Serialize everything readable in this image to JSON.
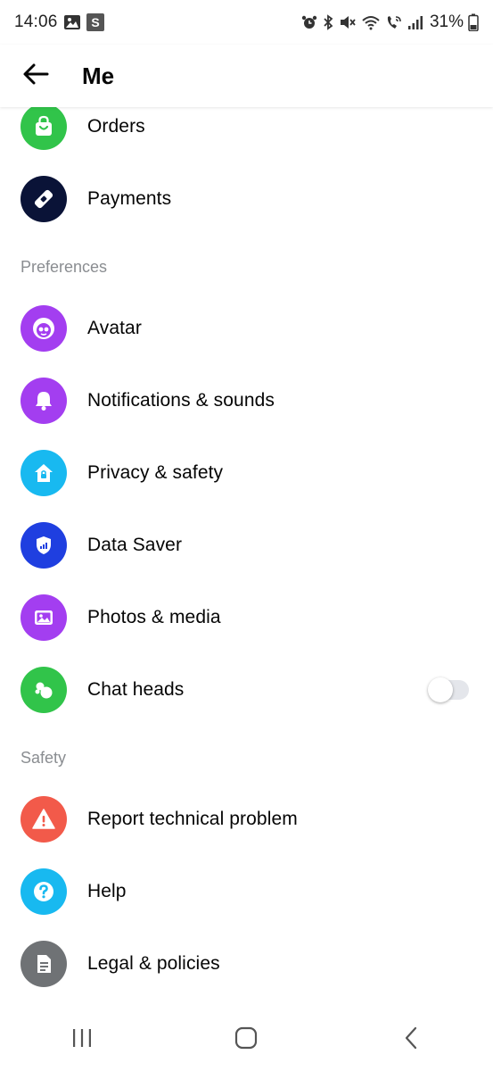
{
  "status_bar": {
    "time": "14:06",
    "battery": "31%",
    "left_icons": [
      "gallery-icon",
      "s-app-icon"
    ],
    "right_icons": [
      "alarm-icon",
      "bluetooth-icon",
      "mute-icon",
      "wifi-icon",
      "wifi-calling-icon",
      "signal-icon",
      "battery-icon"
    ]
  },
  "header": {
    "title": "Me",
    "back_icon": "arrow-left-icon"
  },
  "sections": [
    {
      "label": "",
      "items": [
        {
          "label": "Orders",
          "icon": "shopping-bag-icon",
          "color": "#31c44a"
        },
        {
          "label": "Payments",
          "icon": "tag-icon",
          "color": "#0a1337"
        }
      ]
    },
    {
      "label": "Preferences",
      "items": [
        {
          "label": "Avatar",
          "icon": "avatar-face-icon",
          "color": "#a33ef0"
        },
        {
          "label": "Notifications & sounds",
          "icon": "bell-icon",
          "color": "#a33ef0"
        },
        {
          "label": "Privacy & safety",
          "icon": "house-lock-icon",
          "color": "#18b9f0"
        },
        {
          "label": "Data Saver",
          "icon": "shield-signal-icon",
          "color": "#1f3fe0"
        },
        {
          "label": "Photos & media",
          "icon": "photo-icon",
          "color": "#a33ef0"
        },
        {
          "label": "Chat heads",
          "icon": "chat-heads-icon",
          "color": "#31c44a",
          "toggle": false
        }
      ]
    },
    {
      "label": "Safety",
      "items": [
        {
          "label": "Report technical problem",
          "icon": "warning-icon",
          "color": "#f25a4a"
        },
        {
          "label": "Help",
          "icon": "question-icon",
          "color": "#18b9f0"
        },
        {
          "label": "Legal & policies",
          "icon": "document-icon",
          "color": "#6f7275"
        }
      ]
    }
  ],
  "nav_bar": {
    "recents_icon": "recents-icon",
    "home_icon": "home-icon",
    "back_icon": "nav-back-icon"
  }
}
